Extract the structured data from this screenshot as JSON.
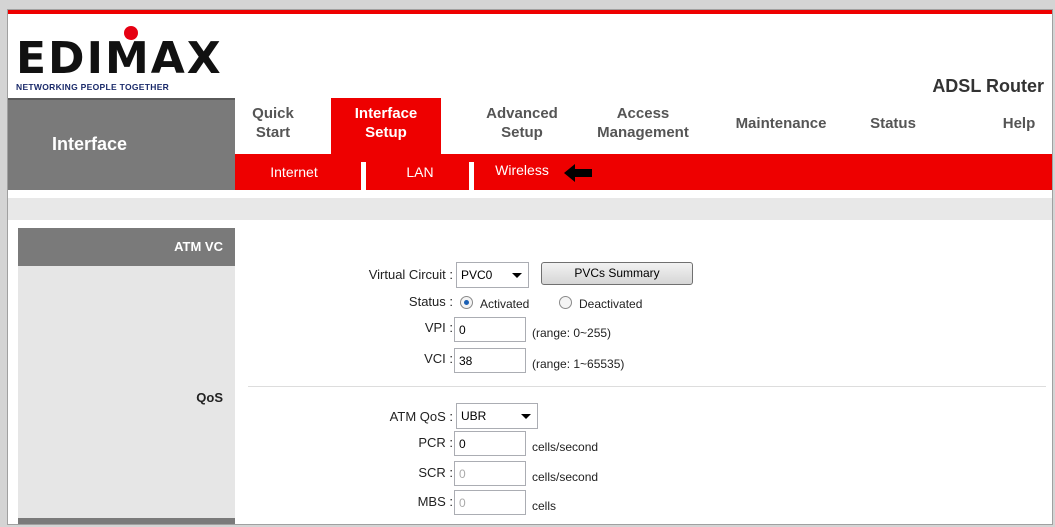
{
  "header": {
    "logo_text": "EDIMAX",
    "tagline": "NETWORKING PEOPLE TOGETHER",
    "product": "ADSL Router"
  },
  "nav": {
    "section_title": "Interface",
    "tabs": [
      {
        "l1": "Quick",
        "l2": "Start"
      },
      {
        "l1": "Interface",
        "l2": "Setup"
      },
      {
        "l1": "Advanced",
        "l2": "Setup"
      },
      {
        "l1": "Access",
        "l2": "Management"
      },
      {
        "l1": "Maintenance",
        "l2": ""
      },
      {
        "l1": "Status",
        "l2": ""
      },
      {
        "l1": "Help",
        "l2": ""
      }
    ],
    "active_tab": "Interface Setup",
    "subtabs": [
      "Internet",
      "LAN",
      "Wireless"
    ]
  },
  "sections": {
    "atm_vc": "ATM VC",
    "qos": "QoS"
  },
  "form": {
    "virtual_circuit": {
      "label": "Virtual Circuit :",
      "value": "PVC0"
    },
    "pvcs_summary_button": "PVCs Summary",
    "status": {
      "label": "Status :",
      "options": [
        "Activated",
        "Deactivated"
      ],
      "selected": "Activated"
    },
    "vpi": {
      "label": "VPI :",
      "value": "0",
      "hint": "(range: 0~255)"
    },
    "vci": {
      "label": "VCI :",
      "value": "38",
      "hint": "(range: 1~65535)"
    },
    "atm_qos": {
      "label": "ATM QoS :",
      "value": "UBR"
    },
    "pcr": {
      "label": "PCR :",
      "value": "0",
      "unit": "cells/second"
    },
    "scr": {
      "label": "SCR :",
      "value": "0",
      "unit": "cells/second"
    },
    "mbs": {
      "label": "MBS :",
      "value": "0",
      "unit": "cells"
    }
  },
  "colors": {
    "brand_red": "#ee0000",
    "nav_gray": "#7a7a7a"
  }
}
